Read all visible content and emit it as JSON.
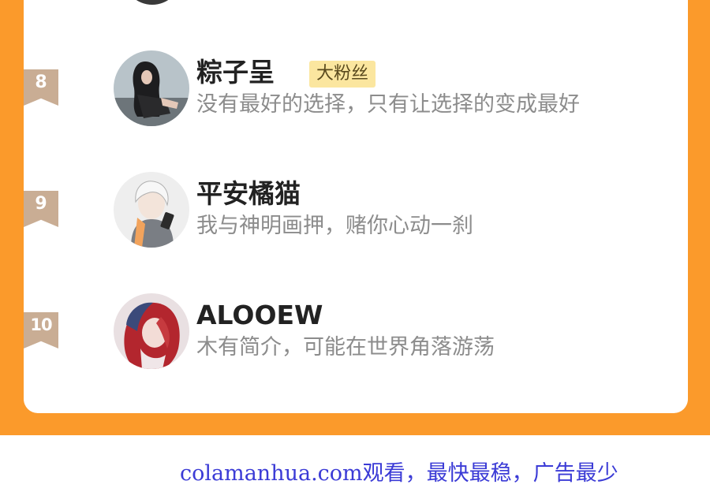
{
  "ranking": [
    {
      "rank": "8",
      "name": "粽子呈",
      "tag": "大粉丝",
      "bio": "没有最好的选择，只有让选择的变成最好",
      "avatar_icon": "avatar-girl-dark-hair"
    },
    {
      "rank": "9",
      "name": "平安橘猫",
      "tag": "",
      "bio": "我与神明画押，赌你心动一刹",
      "avatar_icon": "avatar-white-hair-boy"
    },
    {
      "rank": "10",
      "name": "ALOOEW",
      "tag": "",
      "bio": "木有简介，可能在世界角落游荡",
      "avatar_icon": "avatar-red-hair-girl"
    }
  ],
  "footer": {
    "text": "colamanhua.com观看，最快最稳，广告最少"
  },
  "colors": {
    "background_orange": "#fb9a2b",
    "badge": "#c9ad94",
    "tag_bg": "#fbe69f",
    "footer_text": "#3b3bd6"
  }
}
